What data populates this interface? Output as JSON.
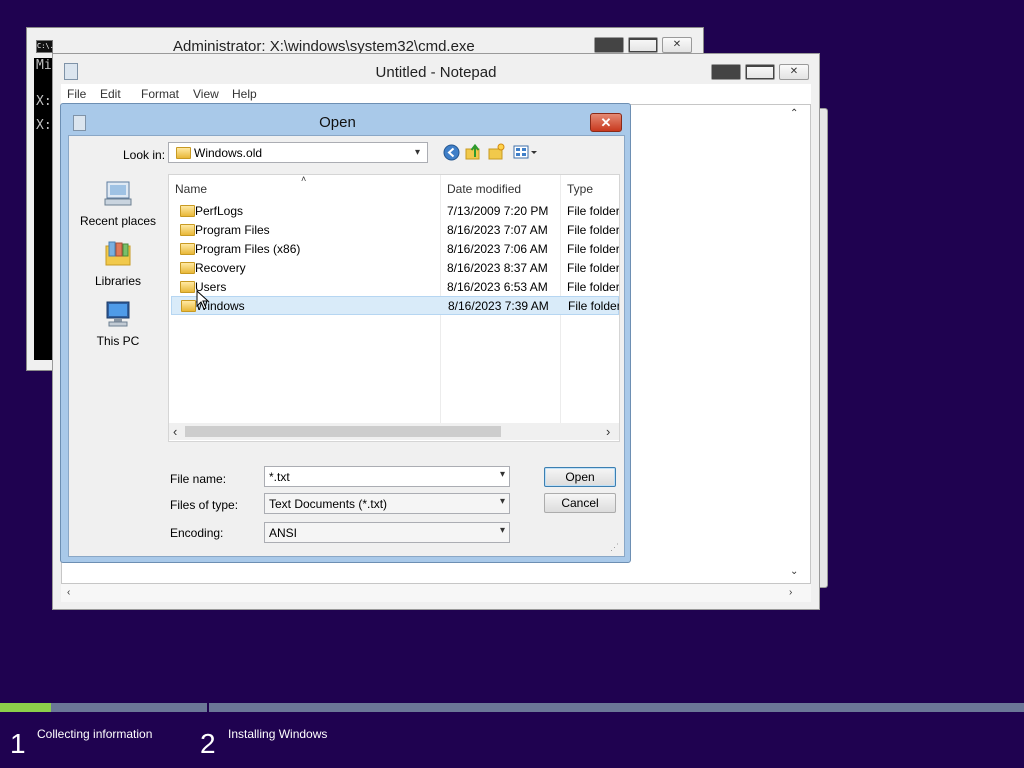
{
  "cmd": {
    "title": "Administrator: X:\\windows\\system32\\cmd.exe",
    "icon_text": "C:\\.",
    "console_lines": [
      "Mi",
      "X:",
      "X:"
    ]
  },
  "notepad": {
    "title": "Untitled - Notepad",
    "menu": [
      "File",
      "Edit",
      "Format",
      "View",
      "Help"
    ]
  },
  "dialog": {
    "title": "Open",
    "close_glyph": "✕",
    "look_in_label": "Look in:",
    "look_in_value": "Windows.old",
    "places": [
      {
        "label": "Recent places",
        "icon": "recent-places-icon"
      },
      {
        "label": "Libraries",
        "icon": "libraries-icon"
      },
      {
        "label": "This PC",
        "icon": "this-pc-icon"
      }
    ],
    "columns": {
      "name": "Name",
      "date": "Date modified",
      "type": "Type"
    },
    "files": [
      {
        "name": "PerfLogs",
        "date": "7/13/2009 7:20 PM",
        "type": "File folder"
      },
      {
        "name": "Program Files",
        "date": "8/16/2023 7:07 AM",
        "type": "File folder"
      },
      {
        "name": "Program Files (x86)",
        "date": "8/16/2023 7:06 AM",
        "type": "File folder"
      },
      {
        "name": "Recovery",
        "date": "8/16/2023 8:37 AM",
        "type": "File folder"
      },
      {
        "name": "Users",
        "date": "8/16/2023 6:53 AM",
        "type": "File folder"
      },
      {
        "name": "Windows",
        "date": "8/16/2023 7:39 AM",
        "type": "File folder",
        "selected": true
      }
    ],
    "file_name_label": "File name:",
    "file_name_value": "*.txt",
    "files_of_type_label": "Files of type:",
    "files_of_type_value": "Text Documents (*.txt)",
    "encoding_label": "Encoding:",
    "encoding_value": "ANSI",
    "open_button": "Open",
    "cancel_button": "Cancel"
  },
  "setup": {
    "progress_fraction": 0.05,
    "steps": [
      {
        "number": "1",
        "label": "Collecting information"
      },
      {
        "number": "2",
        "label": "Installing Windows"
      }
    ]
  },
  "colors": {
    "background": "#1f0250",
    "progress_fill": "#8ccf4a",
    "progress_track": "#6b7797",
    "selection": "#d9ebf9"
  }
}
